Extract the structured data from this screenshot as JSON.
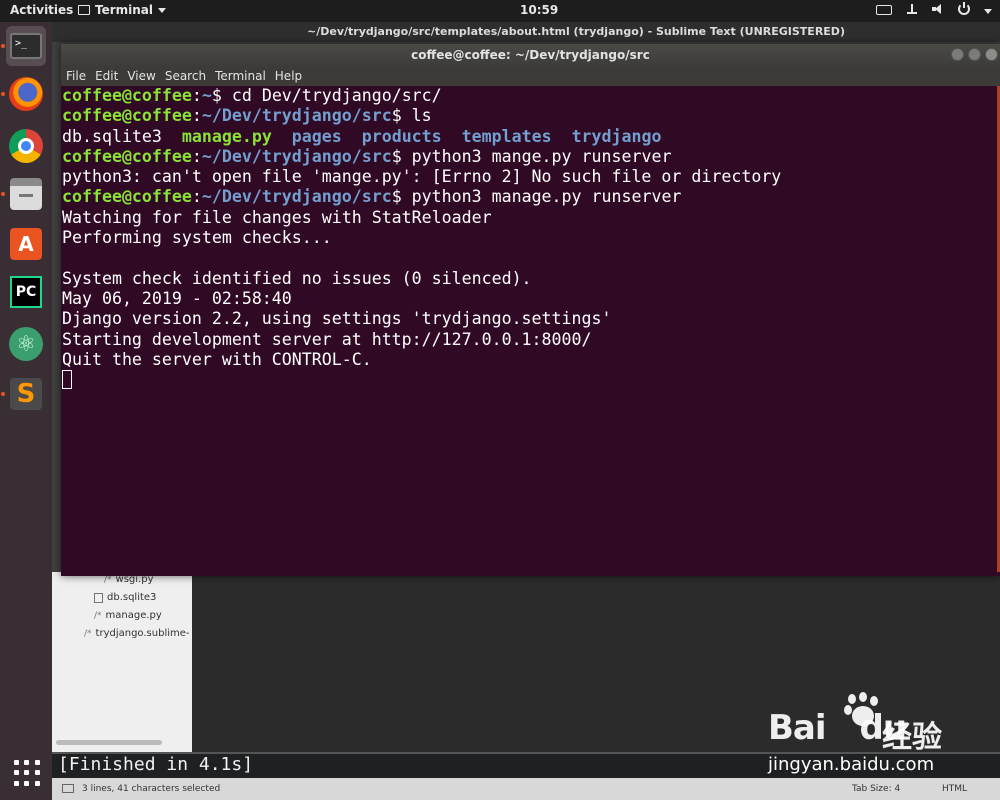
{
  "topbar": {
    "activities": "Activities",
    "app_name": "Terminal",
    "clock": "10:59"
  },
  "dock": {
    "items": [
      {
        "name": "Terminal",
        "glyph": ">_",
        "icon": "terminal-icon",
        "running": true
      },
      {
        "name": "Firefox",
        "icon": "firefox-icon",
        "running": true
      },
      {
        "name": "Chrome",
        "icon": "chrome-icon",
        "running": false
      },
      {
        "name": "Files",
        "icon": "files-icon",
        "running": true
      },
      {
        "name": "Software",
        "glyph": "A",
        "icon": "software-center-icon",
        "running": false
      },
      {
        "name": "PyCharm",
        "glyph": "PC",
        "icon": "pycharm-icon",
        "running": false
      },
      {
        "name": "Atom",
        "glyph": "⚛",
        "icon": "atom-icon",
        "running": false
      },
      {
        "name": "Sublime Text",
        "glyph": "S",
        "icon": "sublime-text-icon",
        "running": true
      }
    ],
    "accent": "#e95420"
  },
  "sublime": {
    "title": "~/Dev/trydjango/src/templates/about.html (trydjango) - Sublime Text (UNREGISTERED)",
    "sidebar_files": [
      {
        "prefix": "/*",
        "name": "wsgi.py"
      },
      {
        "prefix": "",
        "name": "db.sqlite3"
      },
      {
        "prefix": "/*",
        "name": "manage.py"
      },
      {
        "prefix": "/*",
        "name": "trydjango.sublime-"
      }
    ],
    "build_output": "[Finished in 4.1s]",
    "status_selection": "3 lines, 41 characters selected",
    "status_tab": "Tab Size: 4",
    "status_syntax": "HTML"
  },
  "terminal": {
    "title": "coffee@coffee: ~/Dev/trydjango/src",
    "menu": [
      "File",
      "Edit",
      "View",
      "Search",
      "Terminal",
      "Help"
    ],
    "lines": [
      [
        {
          "text": "coffee@coffee",
          "style": "green"
        },
        {
          "text": ":",
          "style": "white"
        },
        {
          "text": "~",
          "style": "blue"
        },
        {
          "text": "$ cd Dev/trydjango/src/",
          "style": "white"
        }
      ],
      [
        {
          "text": "coffee@coffee",
          "style": "green"
        },
        {
          "text": ":",
          "style": "white"
        },
        {
          "text": "~/Dev/trydjango/src",
          "style": "blue"
        },
        {
          "text": "$ ls",
          "style": "white"
        }
      ],
      [
        {
          "text": "db.sqlite3  ",
          "style": "white"
        },
        {
          "text": "manage.py",
          "style": "green"
        },
        {
          "text": "  ",
          "style": "white"
        },
        {
          "text": "pages",
          "style": "blue"
        },
        {
          "text": "  ",
          "style": "white"
        },
        {
          "text": "products",
          "style": "blue"
        },
        {
          "text": "  ",
          "style": "white"
        },
        {
          "text": "templates",
          "style": "blue"
        },
        {
          "text": "  ",
          "style": "white"
        },
        {
          "text": "trydjango",
          "style": "blue"
        }
      ],
      [
        {
          "text": "coffee@coffee",
          "style": "green"
        },
        {
          "text": ":",
          "style": "white"
        },
        {
          "text": "~/Dev/trydjango/src",
          "style": "blue"
        },
        {
          "text": "$ python3 mange.py runserver",
          "style": "white"
        }
      ],
      [
        {
          "text": "python3: can't open file 'mange.py': [Errno 2] No such file or directory",
          "style": "white"
        }
      ],
      [
        {
          "text": "coffee@coffee",
          "style": "green"
        },
        {
          "text": ":",
          "style": "white"
        },
        {
          "text": "~/Dev/trydjango/src",
          "style": "blue"
        },
        {
          "text": "$ python3 manage.py runserver",
          "style": "white"
        }
      ],
      [
        {
          "text": "Watching for file changes with StatReloader",
          "style": "white"
        }
      ],
      [
        {
          "text": "Performing system checks...",
          "style": "white"
        }
      ],
      [
        {
          "text": "",
          "style": "white"
        }
      ],
      [
        {
          "text": "System check identified no issues (0 silenced).",
          "style": "white"
        }
      ],
      [
        {
          "text": "May 06, 2019 - 02:58:40",
          "style": "white"
        }
      ],
      [
        {
          "text": "Django version 2.2, using settings 'trydjango.settings'",
          "style": "white"
        }
      ],
      [
        {
          "text": "Starting development server at http://127.0.0.1:8000/",
          "style": "white"
        }
      ],
      [
        {
          "text": "Quit the server with CONTROL-C.",
          "style": "white"
        }
      ]
    ],
    "colors": {
      "background": "#300a24",
      "green": "#8ae234",
      "blue": "#729fcf",
      "white": "#ffffff"
    }
  },
  "watermark": {
    "brand_latin": "Bai",
    "brand_du": "du",
    "brand_cn": "经验",
    "url": "jingyan.baidu.com"
  }
}
